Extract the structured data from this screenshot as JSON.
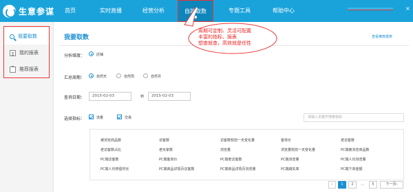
{
  "app": {
    "logo_text": "生意参谋"
  },
  "topnav": {
    "items": [
      {
        "label": "首页"
      },
      {
        "label": "实时直播"
      },
      {
        "label": "经营分析"
      },
      {
        "label": "自助取数"
      },
      {
        "label": "专题工具"
      },
      {
        "label": "帮助中心"
      }
    ],
    "active_index": 3,
    "close_glyph": "×"
  },
  "sidebar": {
    "items": [
      {
        "label": "我要取数",
        "icon": "search-icon"
      },
      {
        "label": "我的报表",
        "icon": "report-icon"
      },
      {
        "label": "推荐报表",
        "icon": "clipboard-icon"
      }
    ]
  },
  "main": {
    "title": "我要取数",
    "view_recommended_link": "查看推荐报表",
    "dimension": {
      "label": "分析维度：",
      "option": "店铺"
    },
    "period": {
      "label": "汇总周期：",
      "options": [
        "自然天",
        "自然周",
        "自然月"
      ],
      "selected_index": 0
    },
    "query_date": {
      "label": "查询日期：",
      "from": "2015-02-03",
      "to_label": "到",
      "to": "2015-02-03"
    },
    "metrics_select": {
      "label": "选择指标：",
      "checks": [
        {
          "label": "流量",
          "checked": true
        },
        {
          "label": "交易",
          "checked": true
        }
      ],
      "search_placeholder": "请输入关键字搜索指标"
    },
    "metrics_grid": [
      [
        "被浏览商品数",
        "访客数",
        "访客数较前一天变化量",
        "客单价",
        "老访客数"
      ],
      [
        "老访客数占比",
        "老买家数",
        "浏览量",
        "浏览量较前一天变化量",
        "PC端被浏览商品数"
      ],
      [
        "PC端访客数",
        "PC端客单价",
        "PC端老访客数",
        "PC端浏览量",
        "PC端人均浏览量"
      ],
      [
        "PC端人均停留时长",
        "PC端商品详情页访客数",
        "PC端商品详情页浏览量",
        "PC端跳失率",
        "PC端下单金额"
      ]
    ],
    "pagination": {
      "prev": "‹",
      "pages": [
        "1",
        "2"
      ],
      "ellipsis": "…",
      "last": "5",
      "next": "下一页›",
      "current": "1"
    }
  },
  "annotation": {
    "lines": [
      "周期可定制、灵活可配置",
      "丰富的指标、报表",
      "想查就查，高效就是任性"
    ],
    "color": "#e22"
  },
  "colors": {
    "brand": "#1aa3db",
    "accent": "#1a8fd1",
    "highlight": "#e33"
  }
}
